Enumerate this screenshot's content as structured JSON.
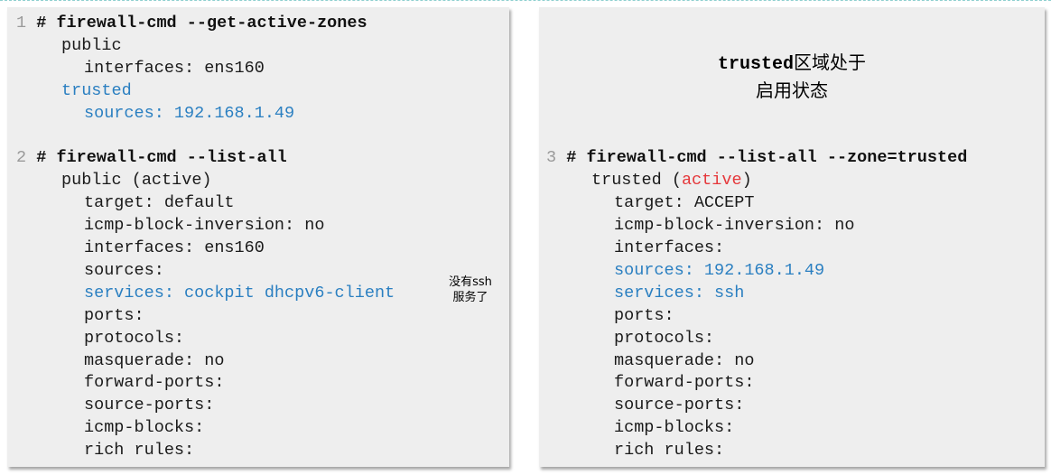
{
  "left_panel": {
    "block1": {
      "num": "1",
      "prompt": "#",
      "command": "firewall-cmd --get-active-zones",
      "lines": [
        "public",
        "interfaces: ens160",
        "trusted",
        "sources: 192.168.1.49"
      ]
    },
    "block2": {
      "num": "2",
      "prompt": "#",
      "command": "firewall-cmd --list-all",
      "zone_line": "public (active)",
      "lines": [
        "target: default",
        "icmp-block-inversion: no",
        "interfaces: ens160",
        "sources:",
        "services: cockpit dhcpv6-client",
        "ports:",
        "protocols:",
        "masquerade: no",
        "forward-ports:",
        "source-ports:",
        "icmp-blocks:",
        "rich rules:"
      ]
    },
    "note": {
      "line1": "没有ssh",
      "line2": "服务了"
    }
  },
  "right_panel": {
    "heading": {
      "bold": "trusted",
      "rest": "区域处于",
      "line2": "启用状态"
    },
    "block3": {
      "num": "3",
      "prompt": "#",
      "command": "firewall-cmd --list-all --zone=trusted",
      "zone_name": "trusted",
      "zone_open": " (",
      "zone_state": "active",
      "zone_close": ")",
      "lines": [
        "target: ACCEPT",
        "icmp-block-inversion: no",
        "interfaces:",
        "sources: 192.168.1.49",
        "services: ssh",
        "ports:",
        "protocols:",
        "masquerade: no",
        "forward-ports:",
        "source-ports:",
        "icmp-blocks:",
        "rich rules:"
      ]
    }
  },
  "colors": {
    "highlight_blue": "#2a7fc1",
    "active_red": "#e5383b",
    "panel_bg": "#eeeeee"
  }
}
